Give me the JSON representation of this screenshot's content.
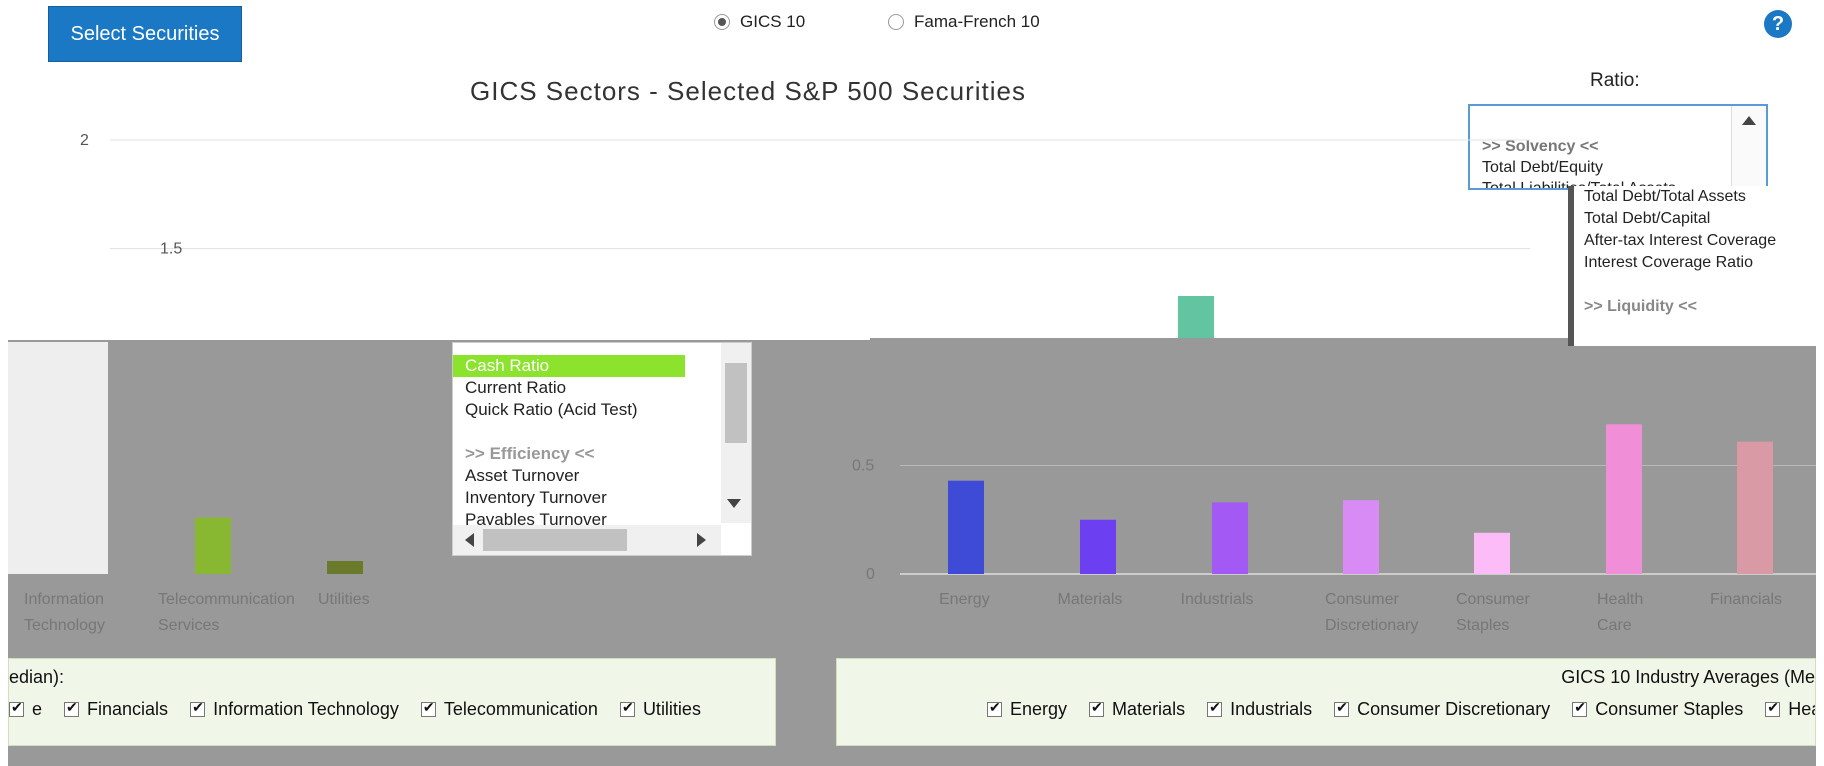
{
  "toolbar": {
    "select_label": "Select Securities",
    "radio_gics": "GICS 10",
    "radio_ff": "Fama-French 10",
    "help": "?"
  },
  "ratio": {
    "label": "Ratio:",
    "top_list": [
      ">> Solvency <<",
      "Total Debt/Equity",
      "Total Liabilities/Total Assets"
    ],
    "overlay_list": [
      "Total Debt/Total Assets",
      "Total Debt/Capital",
      "After-tax Interest Coverage",
      "Interest Coverage Ratio",
      "",
      ">> Liquidity <<"
    ]
  },
  "list_box": {
    "items": [
      "Cash Ratio",
      "Current Ratio",
      "Quick Ratio (Acid Test)",
      "",
      ">> Efficiency <<",
      "Asset Turnover",
      "Inventory Turnover",
      "Payables Turnover"
    ],
    "selected": "Cash Ratio"
  },
  "chart_data": {
    "type": "bar",
    "title": "GICS Sectors - Selected S&P 500 Securities",
    "ylim": [
      0,
      2
    ],
    "yticks": [
      "0",
      "0.5",
      "1.5",
      "2"
    ],
    "grid": true,
    "categories": [
      "Energy",
      "Materials",
      "Industrials",
      "Consumer Discretionary",
      "Consumer Staples",
      "Health Care",
      "Financials",
      "Information Technology",
      "Telecommunication Services",
      "Utilities"
    ],
    "values": [
      0.43,
      0.25,
      0.33,
      0.34,
      0.19,
      0.69,
      0.61,
      1.31,
      0.26,
      0.06
    ],
    "colors": [
      "#3d4bd6",
      "#6c3ff0",
      "#a35af5",
      "#d98bf5",
      "#fcbcf7",
      "#f18ed8",
      "#d99aa6",
      "#63c4a1",
      "#88b731",
      "#6b7a2a"
    ]
  },
  "legend_left": {
    "title": "edian):",
    "items": [
      "e",
      "Financials",
      "Information Technology",
      "Telecommunication",
      "Utilities"
    ]
  },
  "legend_right": {
    "title": "GICS 10 Industry Averages (Me",
    "items": [
      "Energy",
      "Materials",
      "Industrials",
      "Consumer Discretionary",
      "Consumer Staples",
      "Health Car"
    ]
  }
}
